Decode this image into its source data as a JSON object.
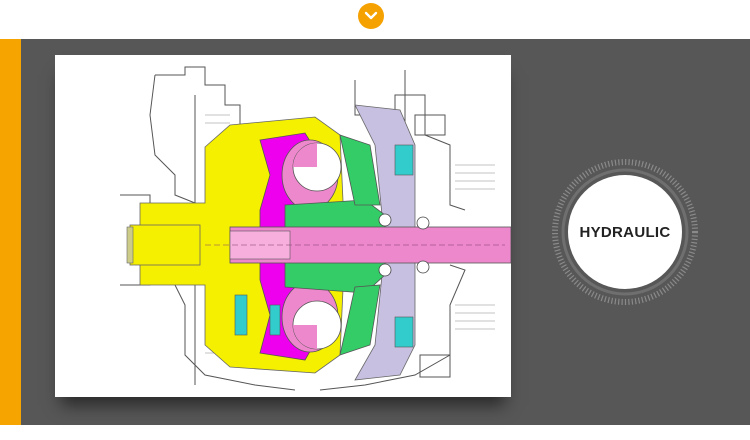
{
  "badge": {
    "label": "HYDRAULIC"
  },
  "scroll_button": {
    "icon": "chevron-down-icon"
  },
  "colors": {
    "accent": "#f5a400",
    "panel": "#575757",
    "diagram_yellow": "#f5f000",
    "diagram_magenta": "#ee00ee",
    "diagram_pink": "#ee88cc",
    "diagram_green": "#33cc66",
    "diagram_cyan": "#33cccc",
    "diagram_lavender": "#c8c0e0"
  },
  "diagram": {
    "subject": "hydraulic-torque-converter-cross-section"
  }
}
